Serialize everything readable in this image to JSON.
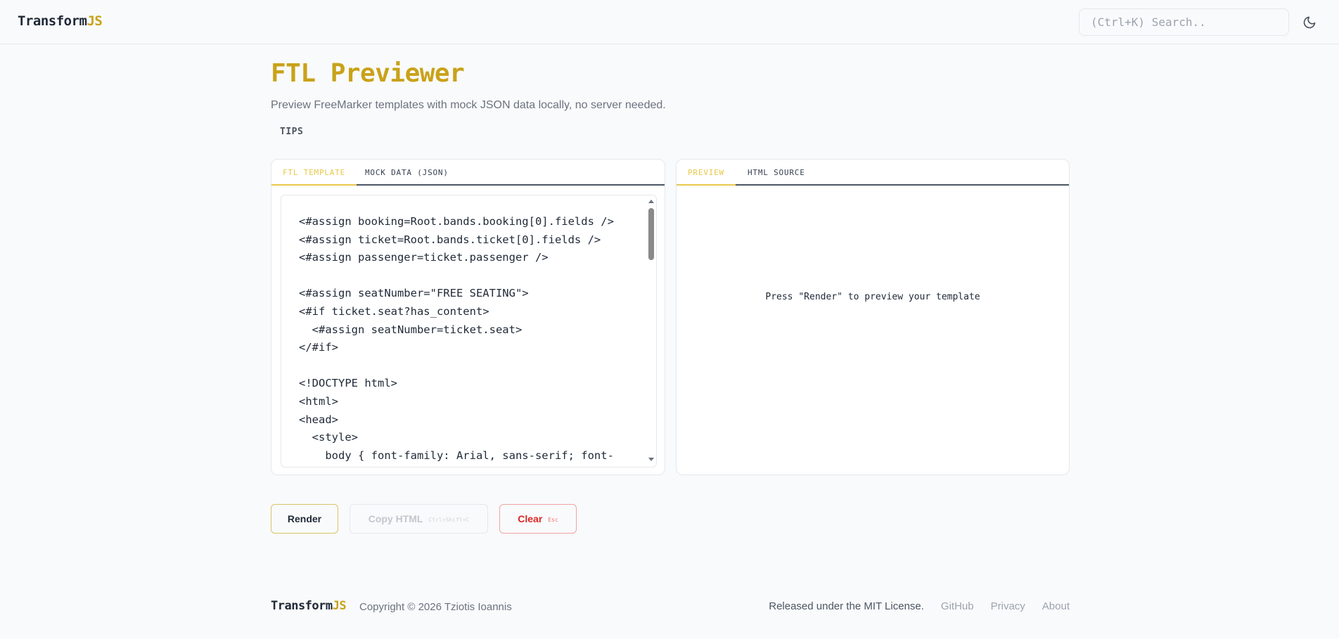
{
  "header": {
    "logo_main": "Transform",
    "logo_accent": "JS",
    "search_placeholder": "(Ctrl+K) Search..",
    "theme_icon": "moon-icon"
  },
  "main": {
    "title": "FTL Previewer",
    "subtitle": "Preview FreeMarker templates with mock JSON data locally, no server needed.",
    "tips_label": "TIPS",
    "left_tabs": [
      "FTL TEMPLATE",
      "MOCK DATA (JSON)"
    ],
    "left_active_tab": "FTL TEMPLATE",
    "right_tabs": [
      "PREVIEW",
      "HTML SOURCE"
    ],
    "right_active_tab": "PREVIEW",
    "template_code": "<#assign booking=Root.bands.booking[0].fields />\n<#assign ticket=Root.bands.ticket[0].fields />\n<#assign passenger=ticket.passenger />\n\n<#assign seatNumber=\"FREE SEATING\">\n<#if ticket.seat?has_content>\n  <#assign seatNumber=ticket.seat>\n</#if>\n\n<!DOCTYPE html>\n<html>\n<head>\n  <style>\n    body { font-family: Arial, sans-serif; font-",
    "preview_placeholder": "Press \"Render\" to preview your template"
  },
  "actions": {
    "render_label": "Render",
    "copy_label": "Copy HTML",
    "copy_shortcut": "Ctrl+Shift+C",
    "clear_label": "Clear",
    "clear_shortcut": "Esc"
  },
  "footer": {
    "logo_main": "Transform",
    "logo_accent": "JS",
    "copyright": "Copyright © 2026 Tziotis Ioannis",
    "license": "Released under the MIT License.",
    "links": [
      "GitHub",
      "Privacy",
      "About"
    ]
  },
  "colors": {
    "accent": "#c9a21a",
    "active_tab": "#e8c84a",
    "danger": "#dc2626",
    "background": "#f9fafb"
  }
}
